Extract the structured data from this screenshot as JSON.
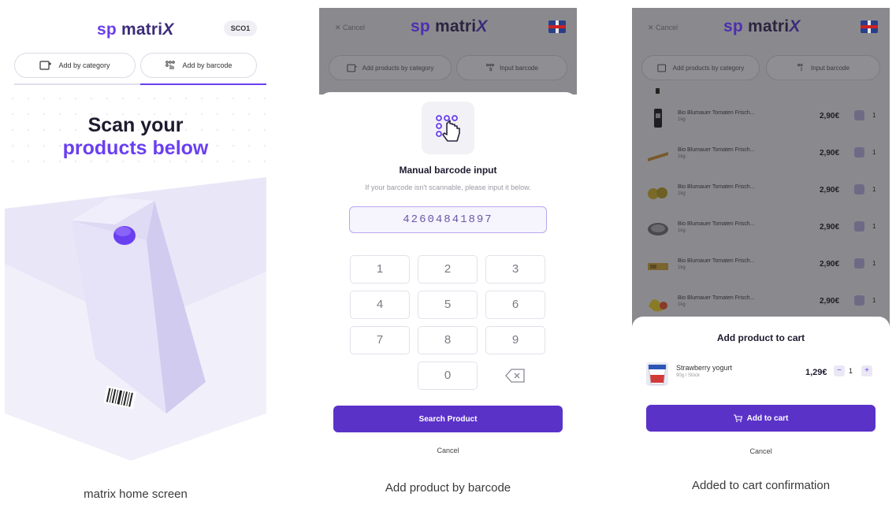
{
  "colors": {
    "brand_purple": "#6a3ff0",
    "button_purple": "#5b32c8",
    "overlay_gray": "#8a8a8e"
  },
  "logo": {
    "sp": "sp",
    "matrix": "matri",
    "x": "X"
  },
  "home": {
    "badge": "SCO1",
    "tab_category": "Add by category",
    "tab_barcode": "Add by barcode",
    "headline_1": "Scan your",
    "headline_2": "products below",
    "barcode_stripes_icon": "barcode-icon",
    "caption": "matrix home screen"
  },
  "barcode_screen": {
    "top_cancel": "✕ Cancel",
    "tab_category": "Add products by category",
    "tab_barcode": "Input barcode",
    "title": "Manual barcode input",
    "subtitle": "If your barcode isn't scannable, please input it below.",
    "input_value": "42604841897",
    "keys": [
      "1",
      "2",
      "3",
      "4",
      "5",
      "6",
      "7",
      "8",
      "9",
      "0"
    ],
    "search_button": "Search Product",
    "cancel": "Cancel",
    "caption": "Add product by barcode"
  },
  "cart_screen": {
    "top_cancel": "✕ Cancel",
    "tab_category": "Add products by category",
    "tab_barcode": "Input barcode",
    "products": [
      {
        "name": "Bio Blumauer Tomaten Frisch...",
        "qty": "1kg",
        "price": "2,90€",
        "count": "1"
      },
      {
        "name": "Bio Blumauer Tomaten Frisch...",
        "qty": "1kg",
        "price": "2,90€",
        "count": "1"
      },
      {
        "name": "Bio Blumauer Tomaten Frisch...",
        "qty": "1kg",
        "price": "2,90€",
        "count": "1"
      },
      {
        "name": "Bio Blumauer Tomaten Frisch...",
        "qty": "1kg",
        "price": "2,90€",
        "count": "1"
      },
      {
        "name": "Bio Blumauer Tomaten Frisch...",
        "qty": "1kg",
        "price": "2,90€",
        "count": "1"
      },
      {
        "name": "Bio Blumauer Tomaten Frisch...",
        "qty": "1kg",
        "price": "2,90€",
        "count": "1"
      }
    ],
    "sheet_title": "Add product to cart",
    "item_name": "Strawberry yogurt",
    "item_qty": "90g / Stück",
    "item_price": "1,29€",
    "stepper_minus": "−",
    "stepper_value": "1",
    "stepper_plus": "+",
    "add_button": "Add to cart",
    "cancel": "Cancel",
    "caption": "Added to cart confirmation"
  }
}
